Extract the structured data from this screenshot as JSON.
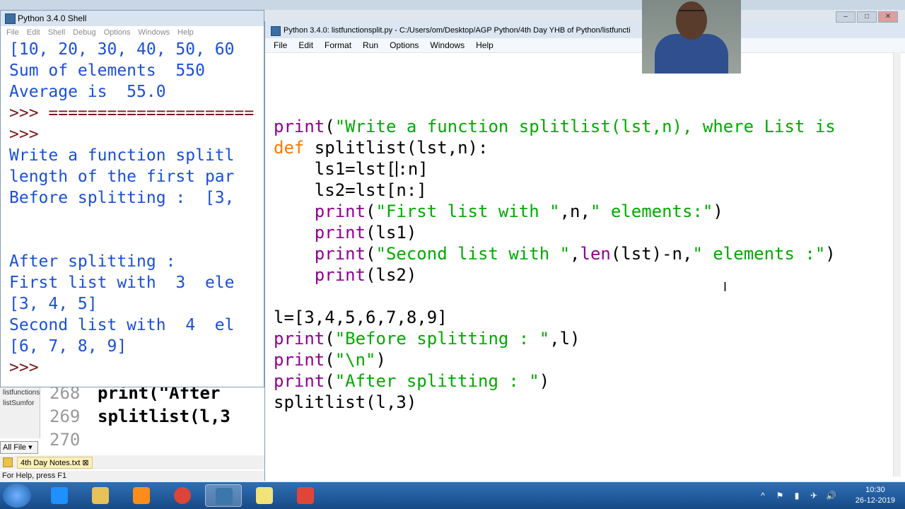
{
  "shell_window": {
    "title": "Python 3.4.0 Shell",
    "menu": [
      "File",
      "Edit",
      "Shell",
      "Debug",
      "Options",
      "Windows",
      "Help"
    ],
    "lines": [
      {
        "text": "[10, 20, 30, 40, 50, 60",
        "kind": "output"
      },
      {
        "text": "Sum of elements  550",
        "kind": "output"
      },
      {
        "text": "Average is  55.0",
        "kind": "output"
      },
      {
        "text": ">>> =====================",
        "kind": "prompt"
      },
      {
        "text": ">>>",
        "kind": "prompt"
      },
      {
        "text": "Write a function splitl",
        "kind": "output"
      },
      {
        "text": "length of the first par",
        "kind": "output"
      },
      {
        "text": "Before splitting :  [3,",
        "kind": "output"
      },
      {
        "text": "",
        "kind": "output"
      },
      {
        "text": "",
        "kind": "output"
      },
      {
        "text": "After splitting :",
        "kind": "output"
      },
      {
        "text": "First list with  3  ele",
        "kind": "output"
      },
      {
        "text": "[3, 4, 5]",
        "kind": "output"
      },
      {
        "text": "Second list with  4  el",
        "kind": "output"
      },
      {
        "text": "[6, 7, 8, 9]",
        "kind": "output"
      },
      {
        "text": ">>>",
        "kind": "prompt"
      }
    ]
  },
  "editor_window": {
    "title": "Python 3.4.0: listfunctionsplit.py - C:/Users/om/Desktop/AGP Python/4th Day YHB of Python/listfuncti",
    "menu": [
      "File",
      "Edit",
      "Format",
      "Run",
      "Options",
      "Windows",
      "Help"
    ],
    "code_lines": [
      [
        {
          "t": "print",
          "c": "bi"
        },
        {
          "t": "(",
          "c": "p"
        },
        {
          "t": "\"Write a function splitlist(lst,n), where List is",
          "c": "str"
        }
      ],
      [
        {
          "t": "def",
          "c": "kw"
        },
        {
          "t": " splitlist(lst,n):",
          "c": "p"
        }
      ],
      [
        {
          "t": "    ls1=lst[",
          "c": "p"
        },
        {
          "t": "",
          "c": "cursor"
        },
        {
          "t": ":n]",
          "c": "p"
        }
      ],
      [
        {
          "t": "    ls2=lst[n:]",
          "c": "p"
        }
      ],
      [
        {
          "t": "    ",
          "c": "p"
        },
        {
          "t": "print",
          "c": "bi"
        },
        {
          "t": "(",
          "c": "p"
        },
        {
          "t": "\"First list with \"",
          "c": "str"
        },
        {
          "t": ",n,",
          "c": "p"
        },
        {
          "t": "\" elements:\"",
          "c": "str"
        },
        {
          "t": ")",
          "c": "p"
        }
      ],
      [
        {
          "t": "    ",
          "c": "p"
        },
        {
          "t": "print",
          "c": "bi"
        },
        {
          "t": "(ls1)",
          "c": "p"
        }
      ],
      [
        {
          "t": "    ",
          "c": "p"
        },
        {
          "t": "print",
          "c": "bi"
        },
        {
          "t": "(",
          "c": "p"
        },
        {
          "t": "\"Second list with \"",
          "c": "str"
        },
        {
          "t": ",",
          "c": "p"
        },
        {
          "t": "len",
          "c": "bi"
        },
        {
          "t": "(lst)-n,",
          "c": "p"
        },
        {
          "t": "\" elements :\"",
          "c": "str"
        },
        {
          "t": ")",
          "c": "p"
        }
      ],
      [
        {
          "t": "    ",
          "c": "p"
        },
        {
          "t": "print",
          "c": "bi"
        },
        {
          "t": "(ls2)",
          "c": "p"
        }
      ],
      [
        {
          "t": "",
          "c": "p"
        }
      ],
      [
        {
          "t": "l=[3,4,5,6,7,8,9]",
          "c": "p"
        }
      ],
      [
        {
          "t": "print",
          "c": "bi"
        },
        {
          "t": "(",
          "c": "p"
        },
        {
          "t": "\"Before splitting : \"",
          "c": "str"
        },
        {
          "t": ",l)",
          "c": "p"
        }
      ],
      [
        {
          "t": "print",
          "c": "bi"
        },
        {
          "t": "(",
          "c": "p"
        },
        {
          "t": "\"\\n\"",
          "c": "str"
        },
        {
          "t": ")",
          "c": "p"
        }
      ],
      [
        {
          "t": "print",
          "c": "bi"
        },
        {
          "t": "(",
          "c": "p"
        },
        {
          "t": "\"After splitting : \"",
          "c": "str"
        },
        {
          "t": ")",
          "c": "p"
        }
      ],
      [
        {
          "t": "splitlist(l,3)",
          "c": "p"
        }
      ]
    ]
  },
  "background_ide": {
    "sidebar_items": [
      "listfunctionsplit",
      "listSumfor"
    ],
    "line_numbers": [
      "268",
      "269",
      "270"
    ],
    "code_lines": [
      "print(\"After",
      "splitlist(l,3",
      ""
    ],
    "filter_label": "All File",
    "notes_tab": "4th Day Notes.txt",
    "status_text": "For Help, press F1"
  },
  "window_controls": [
    "–",
    "□",
    "✕"
  ],
  "taskbar": {
    "apps": [
      {
        "icon": "internet-explorer-icon",
        "color": "#1e90ff"
      },
      {
        "icon": "file-explorer-icon",
        "color": "#e7c15a"
      },
      {
        "icon": "media-player-icon",
        "color": "#ff8c1a"
      },
      {
        "icon": "chrome-icon",
        "color": "#db4437"
      },
      {
        "icon": "python-icon",
        "color": "#3b77a8"
      },
      {
        "icon": "notes-icon",
        "color": "#f2e27a"
      },
      {
        "icon": "eraser-app-icon",
        "color": "#e0453a"
      }
    ],
    "active_index": 4,
    "tray_icons": [
      "^",
      "⚑",
      "▮",
      "✈",
      "🔊"
    ],
    "time": "10:30",
    "date": "26-12-2019"
  }
}
